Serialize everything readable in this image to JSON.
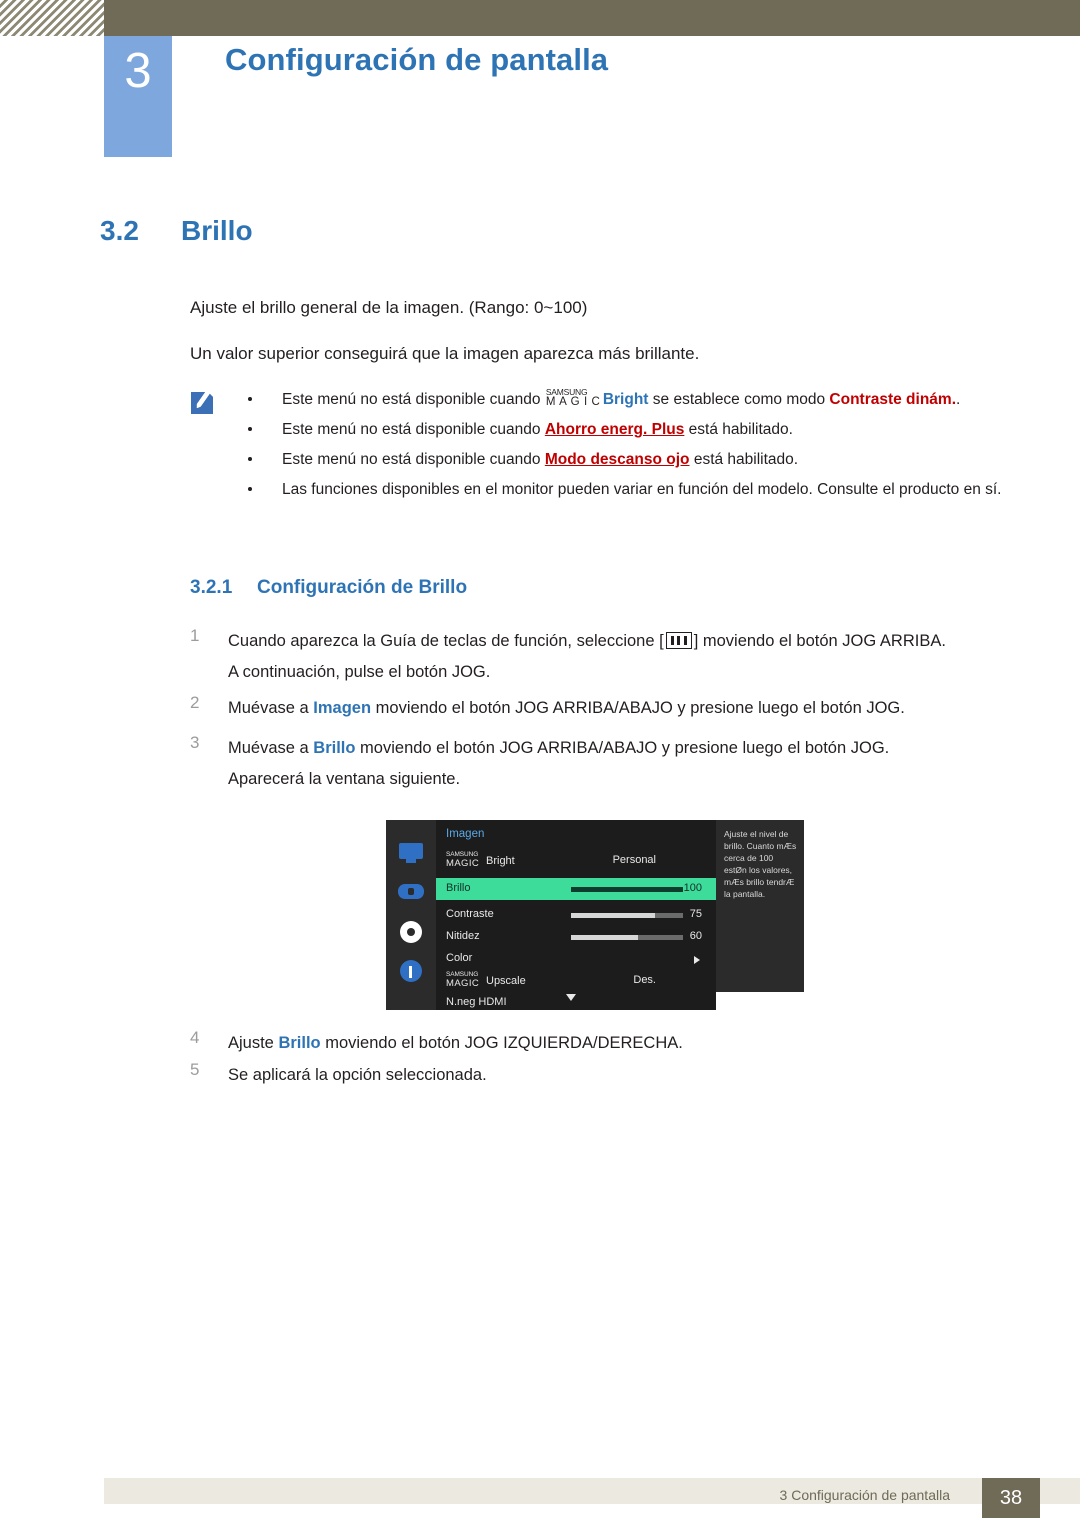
{
  "header": {
    "chapter_number": "3",
    "chapter_title": "Configuración de pantalla"
  },
  "section": {
    "number": "3.2",
    "title": "Brillo"
  },
  "paragraphs": {
    "p1": "Ajuste el brillo general de la imagen. (Rango: 0~100)",
    "p2": "Un valor superior conseguirá que la imagen aparezca más brillante."
  },
  "notes": {
    "b1_pre": "Este menú no está disponible cuando ",
    "b1_magic_top": "SAMSUNG",
    "b1_magic_bottom": "M A G I C",
    "b1_bright": "Bright",
    "b1_mid": " se establece como modo ",
    "b1_red": "Contraste dinám.",
    "b1_end": ".",
    "b2_pre": "Este menú no está disponible cuando ",
    "b2_red": "Ahorro energ. Plus",
    "b2_end": " está habilitado.",
    "b3_pre": "Este menú no está disponible cuando ",
    "b3_red": "Modo descanso ojo",
    "b3_end": " está habilitado.",
    "b4": "Las funciones disponibles en el monitor pueden variar en función del modelo. Consulte el producto en sí."
  },
  "subsection": {
    "number": "3.2.1",
    "title": "Configuración de Brillo"
  },
  "steps": {
    "n1": "1",
    "s1_pre": "Cuando aparezca la Guía de teclas de función, seleccione [",
    "s1_post": "] moviendo el botón JOG ARRIBA.",
    "s1_line2": "A continuación, pulse el botón JOG.",
    "n2": "2",
    "s2_pre": "Muévase a ",
    "s2_word": "Imagen",
    "s2_post": " moviendo el botón JOG ARRIBA/ABAJO y presione luego el botón JOG.",
    "n3": "3",
    "s3_pre": "Muévase a ",
    "s3_word": "Brillo",
    "s3_post": " moviendo el botón JOG ARRIBA/ABAJO y presione luego el botón JOG.",
    "s3_line2": "Aparecerá la ventana siguiente.",
    "n4": "4",
    "s4_pre": "Ajuste ",
    "s4_word": "Brillo",
    "s4_post": " moviendo el botón JOG IZQUIERDA/DERECHA.",
    "n5": "5",
    "s5": "Se aplicará la opción seleccionada."
  },
  "osd": {
    "title": "Imagen",
    "rows": [
      {
        "label_top": "SAMSUNG",
        "label_bottom": "MAGIC",
        "label_suffix": "Bright",
        "value": "Personal",
        "type": "magic"
      },
      {
        "label": "Brillo",
        "value": "100",
        "type": "bar",
        "fill_pct": 100
      },
      {
        "label": "Contraste",
        "value": "75",
        "type": "bar",
        "fill_pct": 75
      },
      {
        "label": "Nitidez",
        "value": "60",
        "type": "bar",
        "fill_pct": 60
      },
      {
        "label": "Color",
        "value": "",
        "type": "arrow"
      },
      {
        "label_top": "SAMSUNG",
        "label_bottom": "MAGIC",
        "label_suffix": "Upscale",
        "value": "Des.",
        "type": "magic"
      },
      {
        "label": "N.neg HDMI",
        "value": "",
        "type": "plain"
      }
    ],
    "help_text": "Ajuste el nivel de brillo. Cuanto mÆs cerca de 100 estØn los valores, mÆs brillo tendrÆ la pantalla."
  },
  "footer": {
    "text": "3 Configuración de pantalla",
    "page": "38"
  }
}
